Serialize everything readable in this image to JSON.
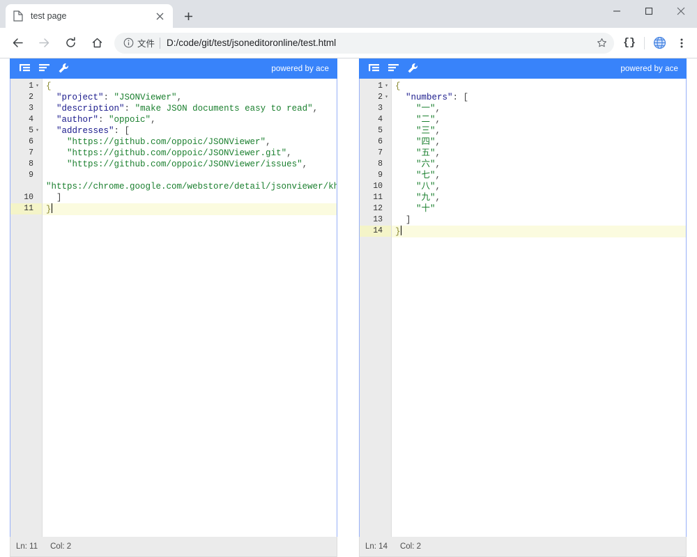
{
  "browser": {
    "tab": {
      "title": "test page",
      "favicon_icon": "page-icon",
      "close_icon": "close-icon"
    },
    "new_tab_icon": "plus-icon",
    "window_controls": [
      {
        "name": "minimize",
        "icon": "minimize-icon"
      },
      {
        "name": "maximize",
        "icon": "maximize-icon"
      },
      {
        "name": "close",
        "icon": "close-window-icon"
      }
    ],
    "nav": [
      {
        "name": "back",
        "icon": "arrow-left-icon"
      },
      {
        "name": "forward",
        "icon": "arrow-right-icon"
      },
      {
        "name": "reload",
        "icon": "reload-icon"
      },
      {
        "name": "home",
        "icon": "home-icon"
      }
    ],
    "omnibox": {
      "info_icon": "info-circle-icon",
      "scheme_label": "文件",
      "url": "D:/code/git/test/jsoneditoronline/test.html",
      "star_icon": "star-icon"
    },
    "extensions": [
      {
        "name": "json-viewer-extension",
        "label": "{}",
        "icon": "braces-icon"
      },
      {
        "name": "globe-extension",
        "label": "",
        "icon": "globe-icon"
      }
    ],
    "menu_icon": "three-dots-icon"
  },
  "theme": {
    "accent_blue": "#3883fa",
    "tabstrip_bg": "#dee1e6",
    "gutter_bg": "#ebebeb",
    "active_line_bg": "#fbfbdf",
    "key_color": "#1a1a8c",
    "string_color": "#1a7f2e"
  },
  "editors": [
    {
      "id": "left-editor",
      "toolbar": {
        "buttons": [
          {
            "name": "format-button",
            "icon": "format-indent-icon",
            "title": "Format"
          },
          {
            "name": "compact-button",
            "icon": "compact-lines-icon",
            "title": "Compact"
          },
          {
            "name": "settings-button",
            "icon": "wrench-icon",
            "title": "Settings"
          }
        ],
        "powered_by": "powered by ace"
      },
      "lines": [
        {
          "num": "1",
          "fold": "▾",
          "active": false,
          "tokens": [
            {
              "t": "brace",
              "v": "{"
            }
          ]
        },
        {
          "num": "2",
          "fold": "",
          "active": false,
          "tokens": [
            {
              "t": "punct",
              "v": "  "
            },
            {
              "t": "key",
              "v": "\"project\""
            },
            {
              "t": "punct",
              "v": ": "
            },
            {
              "t": "str",
              "v": "\"JSONViewer\""
            },
            {
              "t": "punct",
              "v": ","
            }
          ]
        },
        {
          "num": "3",
          "fold": "",
          "active": false,
          "tokens": [
            {
              "t": "punct",
              "v": "  "
            },
            {
              "t": "key",
              "v": "\"description\""
            },
            {
              "t": "punct",
              "v": ": "
            },
            {
              "t": "str",
              "v": "\"make JSON documents easy to read\""
            },
            {
              "t": "punct",
              "v": ","
            }
          ]
        },
        {
          "num": "4",
          "fold": "",
          "active": false,
          "tokens": [
            {
              "t": "punct",
              "v": "  "
            },
            {
              "t": "key",
              "v": "\"author\""
            },
            {
              "t": "punct",
              "v": ": "
            },
            {
              "t": "str",
              "v": "\"oppoic\""
            },
            {
              "t": "punct",
              "v": ","
            }
          ]
        },
        {
          "num": "5",
          "fold": "▾",
          "active": false,
          "tokens": [
            {
              "t": "punct",
              "v": "  "
            },
            {
              "t": "key",
              "v": "\"addresses\""
            },
            {
              "t": "punct",
              "v": ": ["
            }
          ]
        },
        {
          "num": "6",
          "fold": "",
          "active": false,
          "tokens": [
            {
              "t": "punct",
              "v": "    "
            },
            {
              "t": "str",
              "v": "\"https://github.com/oppoic/JSONViewer\""
            },
            {
              "t": "punct",
              "v": ","
            }
          ]
        },
        {
          "num": "7",
          "fold": "",
          "active": false,
          "tokens": [
            {
              "t": "punct",
              "v": "    "
            },
            {
              "t": "str",
              "v": "\"https://github.com/oppoic/JSONViewer.git\""
            },
            {
              "t": "punct",
              "v": ","
            }
          ]
        },
        {
          "num": "8",
          "fold": "",
          "active": false,
          "tokens": [
            {
              "t": "punct",
              "v": "    "
            },
            {
              "t": "str",
              "v": "\"https://github.com/oppoic/JSONViewer/issues\""
            },
            {
              "t": "punct",
              "v": ","
            }
          ]
        },
        {
          "num": "9",
          "fold": "",
          "active": false,
          "wrapped": true,
          "tokens": [
            {
              "t": "punct",
              "v": "    "
            },
            {
              "t": "str",
              "v": "\"https://chrome.google.com/webstore/detail/jsonviewer/khbdpaabobknhhlpglenglkkhdmkfnca\""
            }
          ]
        },
        {
          "num": "10",
          "fold": "",
          "active": false,
          "tokens": [
            {
              "t": "punct",
              "v": "  ]"
            }
          ]
        },
        {
          "num": "11",
          "fold": "",
          "active": true,
          "caret": true,
          "tokens": [
            {
              "t": "brace",
              "v": "}"
            }
          ]
        }
      ],
      "status": {
        "line_label": "Ln: 11",
        "col_label": "Col: 2"
      }
    },
    {
      "id": "right-editor",
      "toolbar": {
        "buttons": [
          {
            "name": "format-button",
            "icon": "format-indent-icon",
            "title": "Format"
          },
          {
            "name": "compact-button",
            "icon": "compact-lines-icon",
            "title": "Compact"
          },
          {
            "name": "settings-button",
            "icon": "wrench-icon",
            "title": "Settings"
          }
        ],
        "powered_by": "powered by ace"
      },
      "lines": [
        {
          "num": "1",
          "fold": "▾",
          "active": false,
          "tokens": [
            {
              "t": "brace",
              "v": "{"
            }
          ]
        },
        {
          "num": "2",
          "fold": "▾",
          "active": false,
          "tokens": [
            {
              "t": "punct",
              "v": "  "
            },
            {
              "t": "key",
              "v": "\"numbers\""
            },
            {
              "t": "punct",
              "v": ": ["
            }
          ]
        },
        {
          "num": "3",
          "fold": "",
          "active": false,
          "tokens": [
            {
              "t": "punct",
              "v": "    "
            },
            {
              "t": "str",
              "v": "\"一\""
            },
            {
              "t": "punct",
              "v": ","
            }
          ]
        },
        {
          "num": "4",
          "fold": "",
          "active": false,
          "tokens": [
            {
              "t": "punct",
              "v": "    "
            },
            {
              "t": "str",
              "v": "\"二\""
            },
            {
              "t": "punct",
              "v": ","
            }
          ]
        },
        {
          "num": "5",
          "fold": "",
          "active": false,
          "tokens": [
            {
              "t": "punct",
              "v": "    "
            },
            {
              "t": "str",
              "v": "\"三\""
            },
            {
              "t": "punct",
              "v": ","
            }
          ]
        },
        {
          "num": "6",
          "fold": "",
          "active": false,
          "tokens": [
            {
              "t": "punct",
              "v": "    "
            },
            {
              "t": "str",
              "v": "\"四\""
            },
            {
              "t": "punct",
              "v": ","
            }
          ]
        },
        {
          "num": "7",
          "fold": "",
          "active": false,
          "tokens": [
            {
              "t": "punct",
              "v": "    "
            },
            {
              "t": "str",
              "v": "\"五\""
            },
            {
              "t": "punct",
              "v": ","
            }
          ]
        },
        {
          "num": "8",
          "fold": "",
          "active": false,
          "tokens": [
            {
              "t": "punct",
              "v": "    "
            },
            {
              "t": "str",
              "v": "\"六\""
            },
            {
              "t": "punct",
              "v": ","
            }
          ]
        },
        {
          "num": "9",
          "fold": "",
          "active": false,
          "tokens": [
            {
              "t": "punct",
              "v": "    "
            },
            {
              "t": "str",
              "v": "\"七\""
            },
            {
              "t": "punct",
              "v": ","
            }
          ]
        },
        {
          "num": "10",
          "fold": "",
          "active": false,
          "tokens": [
            {
              "t": "punct",
              "v": "    "
            },
            {
              "t": "str",
              "v": "\"八\""
            },
            {
              "t": "punct",
              "v": ","
            }
          ]
        },
        {
          "num": "11",
          "fold": "",
          "active": false,
          "tokens": [
            {
              "t": "punct",
              "v": "    "
            },
            {
              "t": "str",
              "v": "\"九\""
            },
            {
              "t": "punct",
              "v": ","
            }
          ]
        },
        {
          "num": "12",
          "fold": "",
          "active": false,
          "tokens": [
            {
              "t": "punct",
              "v": "    "
            },
            {
              "t": "str",
              "v": "\"十\""
            }
          ]
        },
        {
          "num": "13",
          "fold": "",
          "active": false,
          "tokens": [
            {
              "t": "punct",
              "v": "  ]"
            }
          ]
        },
        {
          "num": "14",
          "fold": "",
          "active": true,
          "caret": true,
          "tokens": [
            {
              "t": "brace",
              "v": "}"
            }
          ]
        }
      ],
      "status": {
        "line_label": "Ln: 14",
        "col_label": "Col: 2"
      }
    }
  ]
}
